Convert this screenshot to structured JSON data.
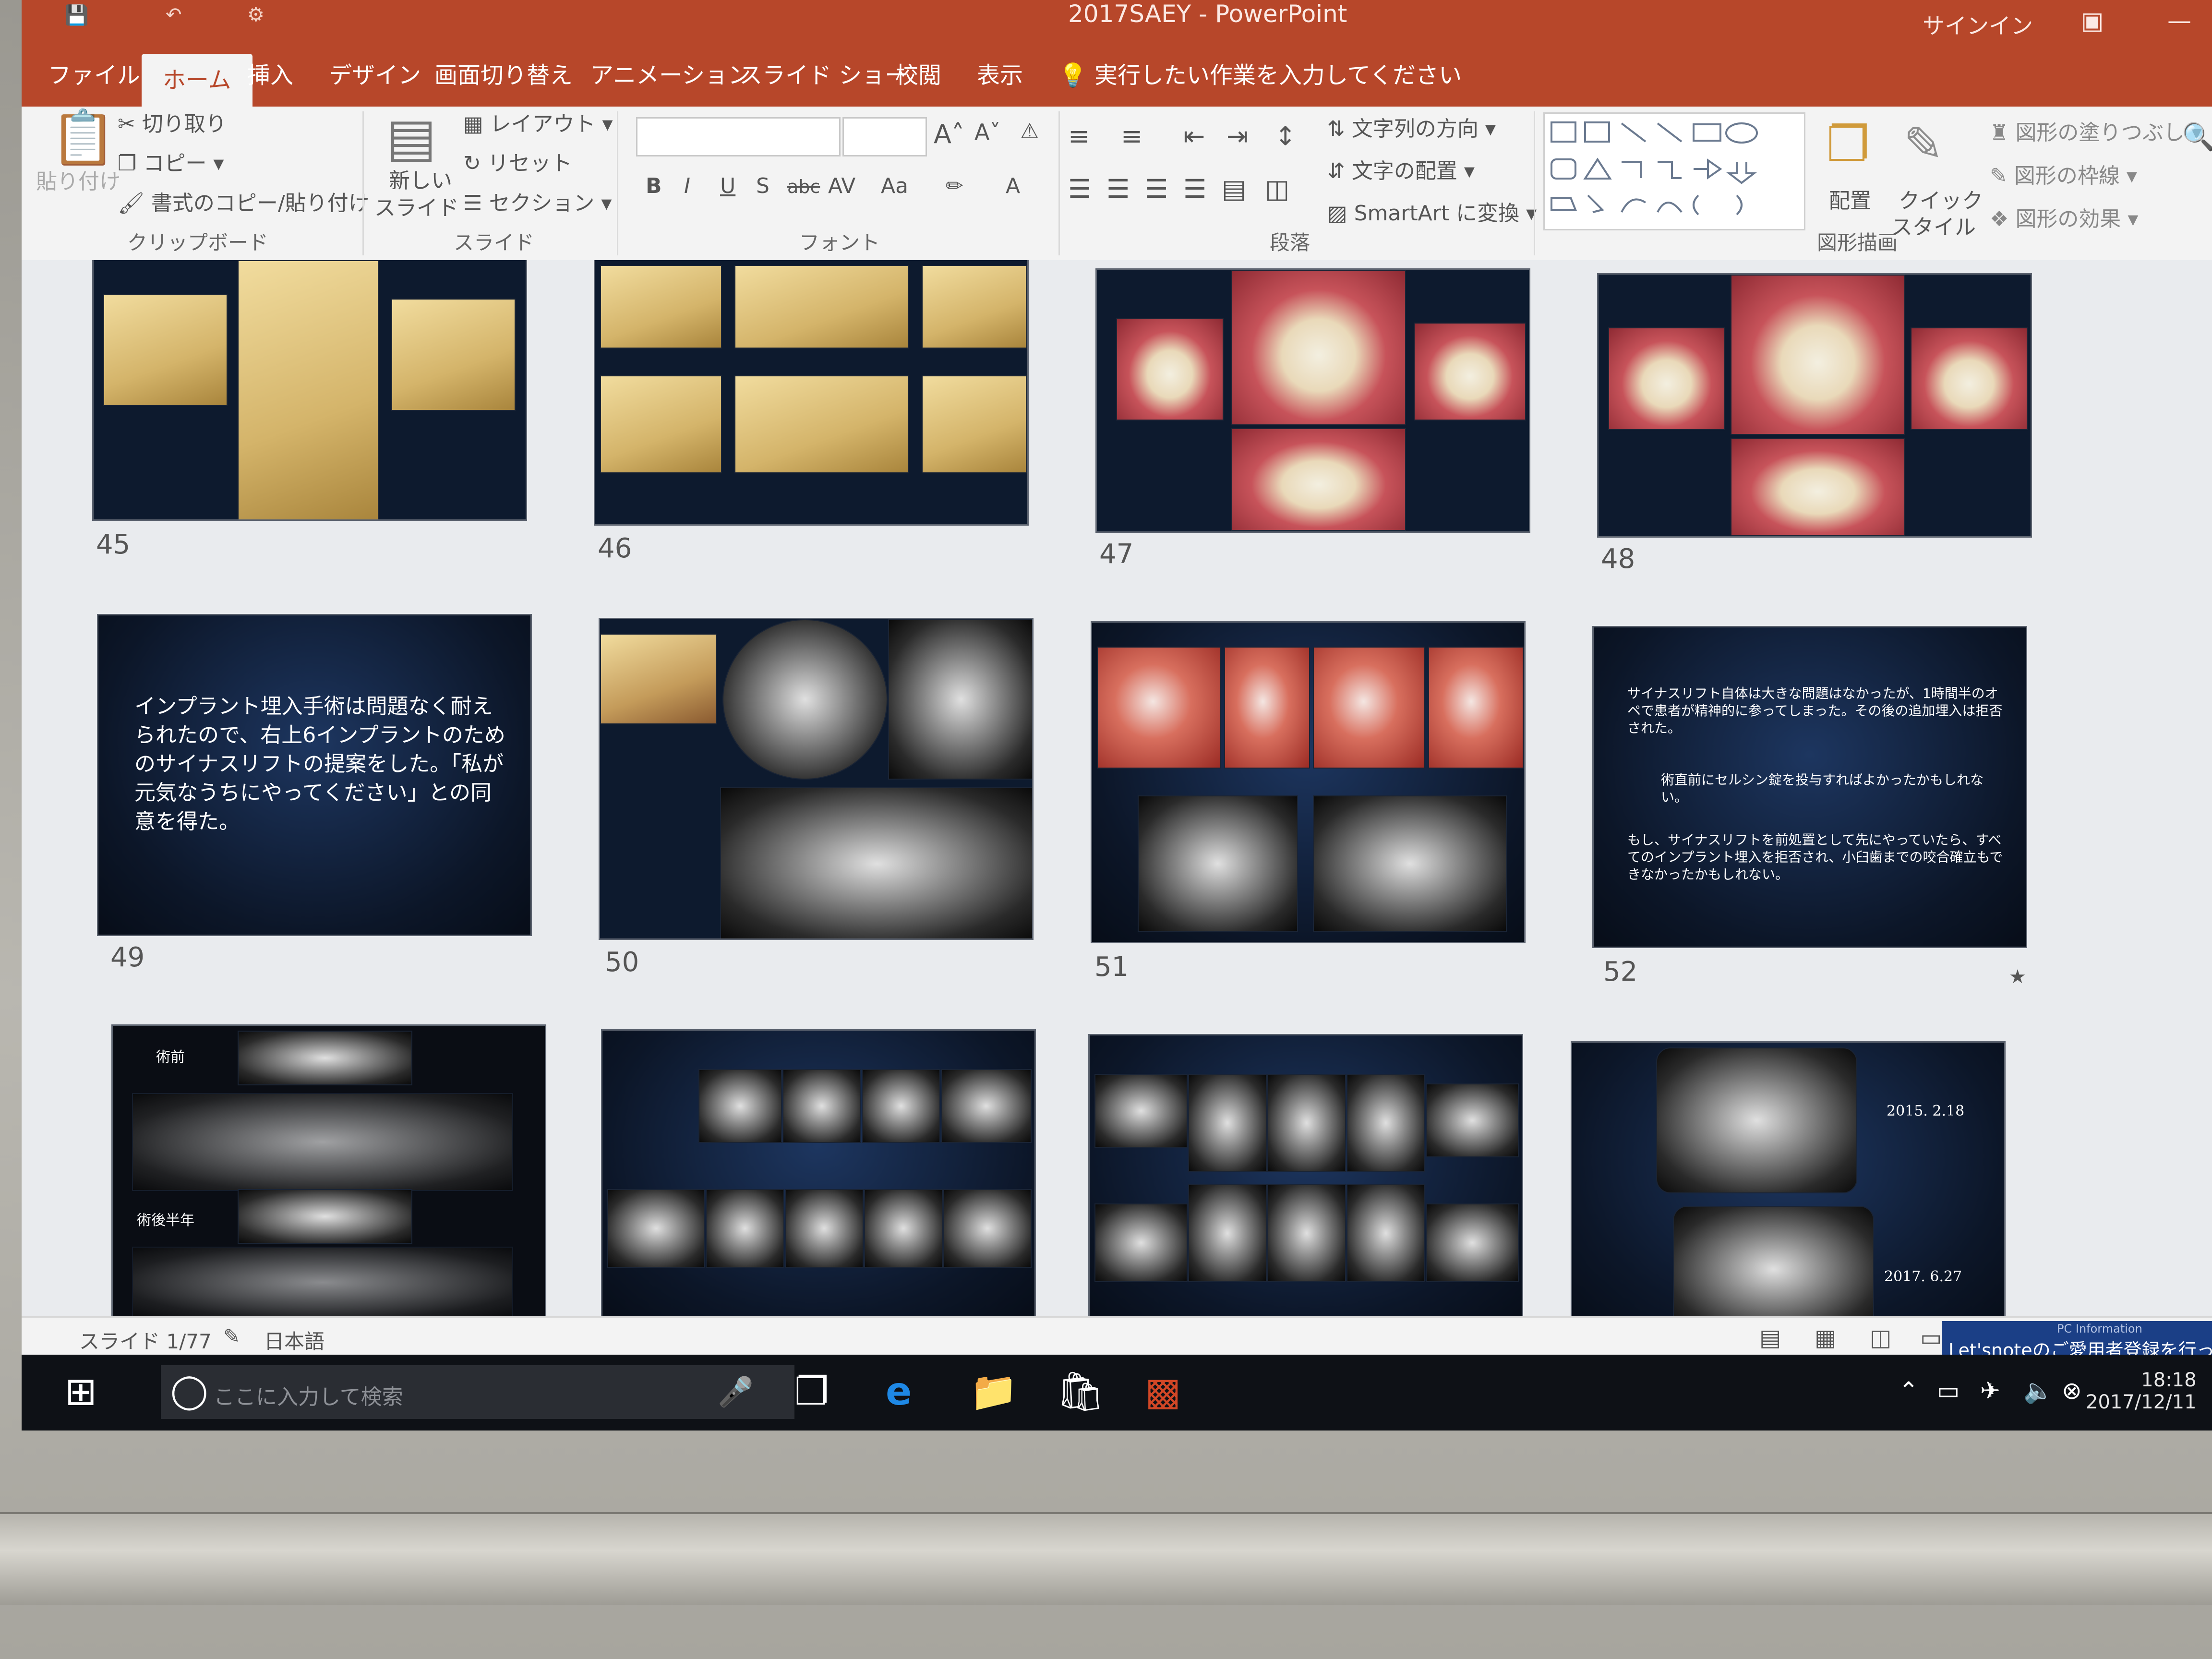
{
  "window": {
    "title": "2017SAEY - PowerPoint",
    "signin": "サインイン",
    "restore_icon": "restore-icon",
    "minimize_icon": "minimize-icon"
  },
  "menu": {
    "tabs": [
      "ファイル",
      "ホーム",
      "挿入",
      "デザイン",
      "画面切り替え",
      "アニメーション",
      "スライド ショー",
      "校閲",
      "表示"
    ],
    "active_tab": "ホーム",
    "tellme": "実行したい作業を入力してください"
  },
  "ribbon": {
    "clipboard": {
      "paste": "貼り付け",
      "cut": "切り取り",
      "copy": "コピー",
      "format_painter": "書式のコピー/貼り付け",
      "label": "クリップボード"
    },
    "slides": {
      "new_slide_line1": "新しい",
      "new_slide_line2": "スライド",
      "layout": "レイアウト",
      "reset": "リセット",
      "section": "セクション",
      "label": "スライド"
    },
    "font": {
      "bold": "B",
      "italic": "I",
      "underline": "U",
      "shadow": "S",
      "strike": "abc",
      "spacing": "AV",
      "case": "Aa",
      "color": "A",
      "label": "フォント"
    },
    "paragraph": {
      "direction": "文字列の方向",
      "align": "文字の配置",
      "smartart": "SmartArt に変換",
      "label": "段落"
    },
    "drawing": {
      "arrange": "配置",
      "quick_style_1": "クイック",
      "quick_style_2": "スタイル",
      "fill": "図形の塗りつぶし",
      "outline": "図形の枠線",
      "effect": "図形の効果",
      "label": "図形描画"
    }
  },
  "slides": {
    "numbers": [
      "45",
      "46",
      "47",
      "48",
      "49",
      "50",
      "51",
      "52"
    ],
    "s49_text": "インプラント埋入手術は問題なく耐えられたので、右上6インプラントのためのサイナスリフトの提案をした。「私が元気なうちにやってください」との同意を得た。",
    "s52_p1": "サイナスリフト自体は大きな問題はなかったが、1時間半のオペで患者が精神的に参ってしまった。その後の追加埋入は拒否された。",
    "s52_p2": "術直前にセルシン錠を投与すればよかったかもしれない。",
    "s52_p3": "もし、サイナスリフトを前処置として先にやっていたら、すべてのインプラント埋入を拒否され、小臼歯までの咬合確立もできなかったかもしれない。",
    "s52_star": "★",
    "s53_before": "術前",
    "s53_after": "術後半年",
    "s56_date1": "2015. 2.18",
    "s56_date2": "2017. 6.27"
  },
  "status": {
    "slide": "スライド 1/77",
    "language": "日本語",
    "banner_title": "PC Information",
    "banner_text": "Let'snoteのご愛用者登録を行って"
  },
  "taskbar": {
    "search": "ここに入力して検索",
    "time": "18:18",
    "date": "2017/12/11"
  }
}
